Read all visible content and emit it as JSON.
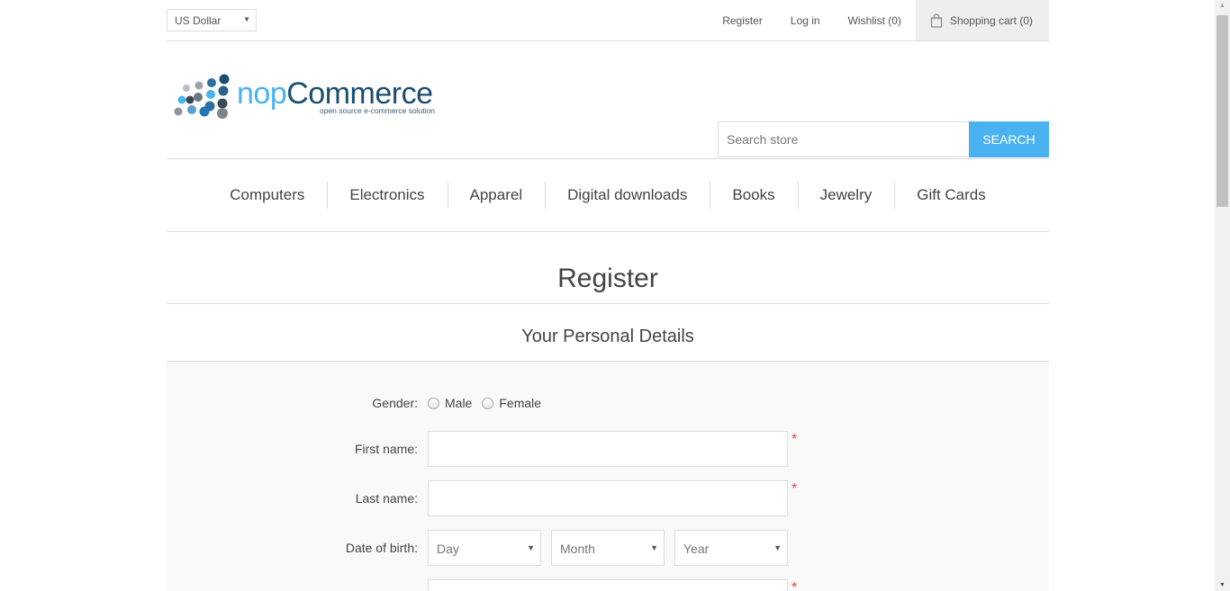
{
  "header": {
    "currency": "US Dollar",
    "links": {
      "register": "Register",
      "login": "Log in",
      "wishlist": "Wishlist (0)",
      "cart": "Shopping cart (0)"
    }
  },
  "logo": {
    "word_nop": "nop",
    "word_commerce": "Commerce",
    "tagline": "open source e-commerce solution"
  },
  "search": {
    "placeholder": "Search store",
    "button": "SEARCH"
  },
  "menu": {
    "items": [
      "Computers",
      "Electronics",
      "Apparel",
      "Digital downloads",
      "Books",
      "Jewelry",
      "Gift Cards"
    ]
  },
  "page": {
    "title": "Register",
    "section": "Your Personal Details"
  },
  "form": {
    "gender_label": "Gender:",
    "gender_male": "Male",
    "gender_female": "Female",
    "first_name_label": "First name:",
    "last_name_label": "Last name:",
    "dob_label": "Date of birth:",
    "dob_day": "Day",
    "dob_month": "Month",
    "dob_year": "Year",
    "required_mark": "*"
  },
  "colors": {
    "accent": "#4ab2f1",
    "logo_dark": "#1c4e6f",
    "required": "#e4434b"
  }
}
